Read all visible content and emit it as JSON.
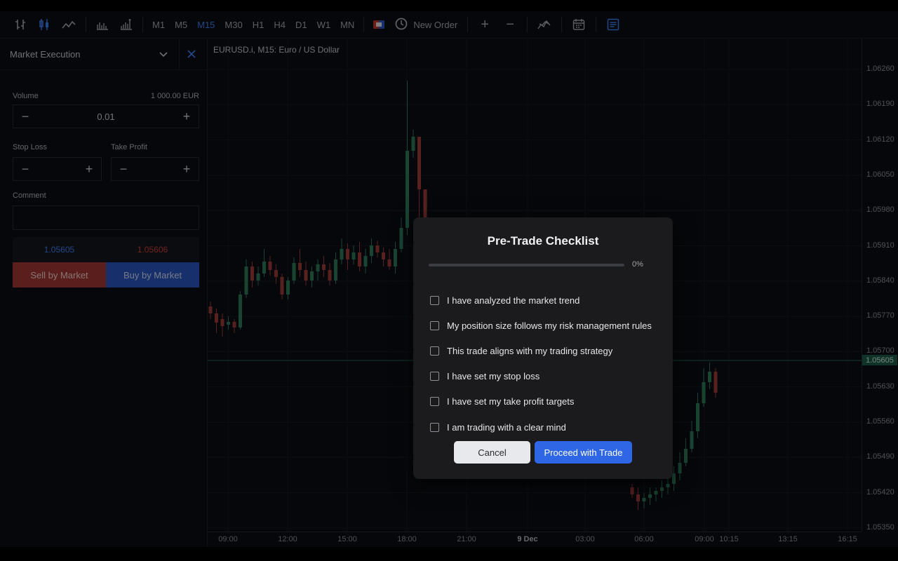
{
  "toolbar": {
    "timeframes": [
      "M1",
      "M5",
      "M15",
      "M30",
      "H1",
      "H4",
      "D1",
      "W1",
      "MN"
    ],
    "active_timeframe": "M15",
    "new_order_label": "New Order"
  },
  "order_panel": {
    "title": "Market Execution",
    "volume_label": "Volume",
    "volume_amount": "1 000.00 EUR",
    "volume_value": "0.01",
    "stop_loss_label": "Stop Loss",
    "take_profit_label": "Take Profit",
    "comment_label": "Comment",
    "bid": "1.05605",
    "ask": "1.05606",
    "sell_label": "Sell by Market",
    "buy_label": "Buy by Market"
  },
  "chart": {
    "title": "EURUSD.i, M15: Euro / US Dollar",
    "price_ticks": [
      "1.06260",
      "1.06190",
      "1.06120",
      "1.06050",
      "1.05980",
      "1.05910",
      "1.05840",
      "1.05770",
      "1.05700",
      "1.05630",
      "1.05560",
      "1.05490",
      "1.05420",
      "1.05350"
    ],
    "current_price": "1.05605",
    "time_ticks": [
      "09:00",
      "12:00",
      "15:00",
      "18:00",
      "21:00",
      "9 Dec",
      "03:00",
      "06:00",
      "09:00",
      "10:15",
      "13:15",
      "16:15"
    ]
  },
  "colors": {
    "bull": "#2e7d5b",
    "bear": "#a13c3a",
    "accent": "#3b82f6",
    "sell": "#a43a36",
    "buy": "#2b58c4"
  },
  "modal": {
    "title": "Pre-Trade Checklist",
    "progress_percent": 0,
    "progress_label": "0%",
    "items": [
      {
        "label": "I have analyzed the market trend",
        "checked": false
      },
      {
        "label": "My position size follows my risk management rules",
        "checked": false
      },
      {
        "label": "This trade aligns with my trading strategy",
        "checked": false
      },
      {
        "label": "I have set my stop loss",
        "checked": false
      },
      {
        "label": "I have set my take profit targets",
        "checked": false
      },
      {
        "label": "I am trading with a clear mind",
        "checked": false
      }
    ],
    "cancel_label": "Cancel",
    "proceed_label": "Proceed with Trade"
  }
}
